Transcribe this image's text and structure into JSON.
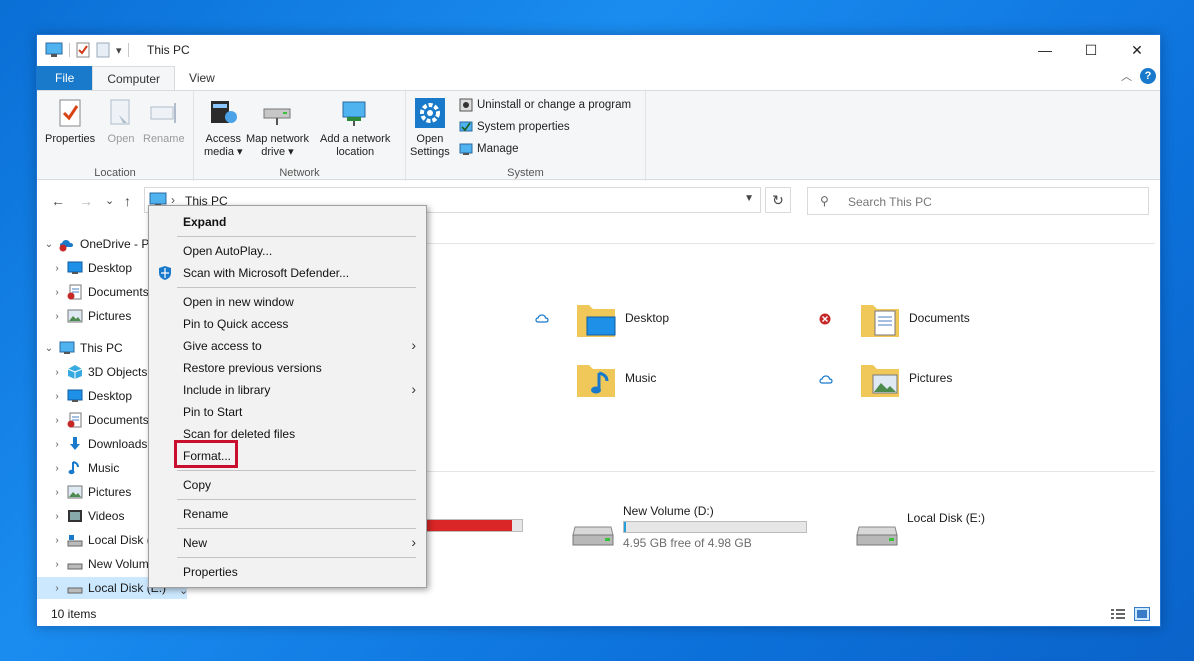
{
  "window": {
    "title": "This PC",
    "qat_dropdown": "▾",
    "controls": {
      "minimize": "—",
      "maximize": "☐",
      "close": "✕"
    }
  },
  "ribbon_tabs": [
    "File",
    "Computer",
    "View"
  ],
  "ribbon": {
    "location": {
      "label": "Location",
      "properties": "Properties",
      "open": "Open",
      "rename": "Rename"
    },
    "network": {
      "label": "Network",
      "access_media": [
        "Access",
        "media ▾"
      ],
      "map_drive": [
        "Map network",
        "drive ▾"
      ],
      "add_location": [
        "Add a network",
        "location"
      ]
    },
    "system": {
      "label": "System",
      "open_settings": [
        "Open",
        "Settings"
      ],
      "uninstall": "Uninstall or change a program",
      "system_properties": "System properties",
      "manage": "Manage"
    }
  },
  "nav": {
    "back": "←",
    "forward": "→",
    "recent": "⌄",
    "up": "↑",
    "breadcrumb": "This PC",
    "refresh": "↻",
    "search_placeholder": "Search This PC"
  },
  "tree": [
    {
      "label": "OneDrive - P",
      "expanded": true
    },
    {
      "label": "Desktop"
    },
    {
      "label": "Documents"
    },
    {
      "label": "Pictures"
    },
    {
      "label": "This PC",
      "expanded": true
    },
    {
      "label": "3D Objects"
    },
    {
      "label": "Desktop"
    },
    {
      "label": "Documents"
    },
    {
      "label": "Downloads"
    },
    {
      "label": "Music"
    },
    {
      "label": "Pictures"
    },
    {
      "label": "Videos"
    },
    {
      "label": "Local Disk (C:)"
    },
    {
      "label": "New Volume (D:)"
    },
    {
      "label": "Local Disk (E:)"
    }
  ],
  "folders": [
    {
      "name": "Desktop"
    },
    {
      "name": "Documents"
    },
    {
      "name": "Music"
    },
    {
      "name": "Pictures"
    }
  ],
  "drives": [
    {
      "name": "New Volume (D:)",
      "free": "4.95 GB free of 4.98 GB",
      "used_fraction": 0.01
    },
    {
      "name": "Local Disk (E:)"
    }
  ],
  "context_menu": {
    "expand": "Expand",
    "open_autoplay": "Open AutoPlay...",
    "scan_defender": "Scan with Microsoft Defender...",
    "open_new_window": "Open in new window",
    "pin_quick_access": "Pin to Quick access",
    "give_access": "Give access to",
    "restore_versions": "Restore previous versions",
    "include_library": "Include in library",
    "pin_start": "Pin to Start",
    "scan_deleted": "Scan for deleted files",
    "format": "Format...",
    "copy": "Copy",
    "rename": "Rename",
    "new": "New",
    "properties": "Properties",
    "arrow": "›"
  },
  "status": {
    "item_count": "10 items",
    "collapse_arrow": "⌄"
  },
  "colors": {
    "accent": "#1979ca",
    "highlight_box": "#c8102e",
    "disk_c_bar": "#da2626"
  }
}
